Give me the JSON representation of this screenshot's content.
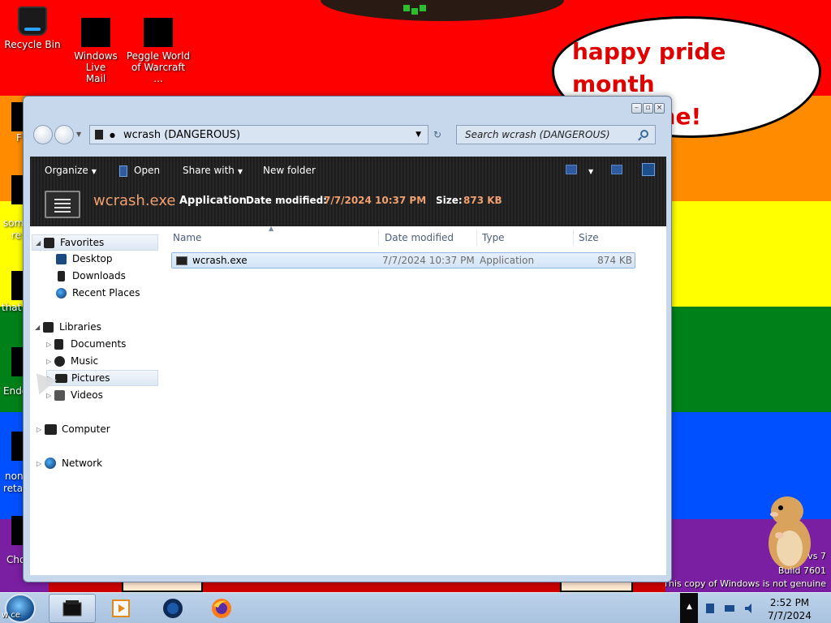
{
  "desktop": {
    "speech_bubble": [
      "happy pride month",
      "everyone!"
    ],
    "icons": [
      {
        "label_lines": [
          "Recycle Bin"
        ]
      },
      {
        "label_lines": [
          "Windows Live",
          "Mail"
        ]
      },
      {
        "label_lines": [
          "Peggle World",
          "of Warcraft ..."
        ]
      }
    ],
    "partial_labels": [
      "F",
      "som",
      "re",
      "that",
      "Ende",
      "non",
      "retar",
      "Cho"
    ],
    "watermark": {
      "line1": "vs 7",
      "line2": "Build 7601",
      "line3": "This copy of Windows is not genuine"
    },
    "colors": {
      "red": "#ff0000",
      "orange": "#ff8c00",
      "yellow": "#ffff00",
      "green": "#008018",
      "blue": "#0050ff",
      "purple": "#7a1fa2"
    }
  },
  "explorer": {
    "address": "wcrash (DANGEROUS)",
    "search_placeholder": "Search wcrash (DANGEROUS)",
    "toolbar": {
      "organize": "Organize",
      "open": "Open",
      "share_with": "Share with",
      "new_folder": "New folder"
    },
    "details": {
      "name": "wcrash.exe",
      "type": "Application",
      "date_label": "Date modified:",
      "date_value": "7/7/2024 10:37 PM",
      "size_label": "Size:",
      "size_value": "873 KB"
    },
    "nav": {
      "favorites": "Favorites",
      "desktop": "Desktop",
      "downloads": "Downloads",
      "recent_places": "Recent Places",
      "libraries": "Libraries",
      "documents": "Documents",
      "music": "Music",
      "pictures": "Pictures",
      "videos": "Videos",
      "computer": "Computer",
      "network": "Network"
    },
    "columns": {
      "name": "Name",
      "date": "Date modified",
      "type": "Type",
      "size": "Size"
    },
    "files": [
      {
        "name": "wcrash.exe",
        "date": "7/7/2024 10:37 PM",
        "type": "Application",
        "size": "874 KB"
      }
    ]
  },
  "taskbar": {
    "start_label": "w       ce",
    "time": "2:52 PM",
    "date": "7/7/2024"
  }
}
